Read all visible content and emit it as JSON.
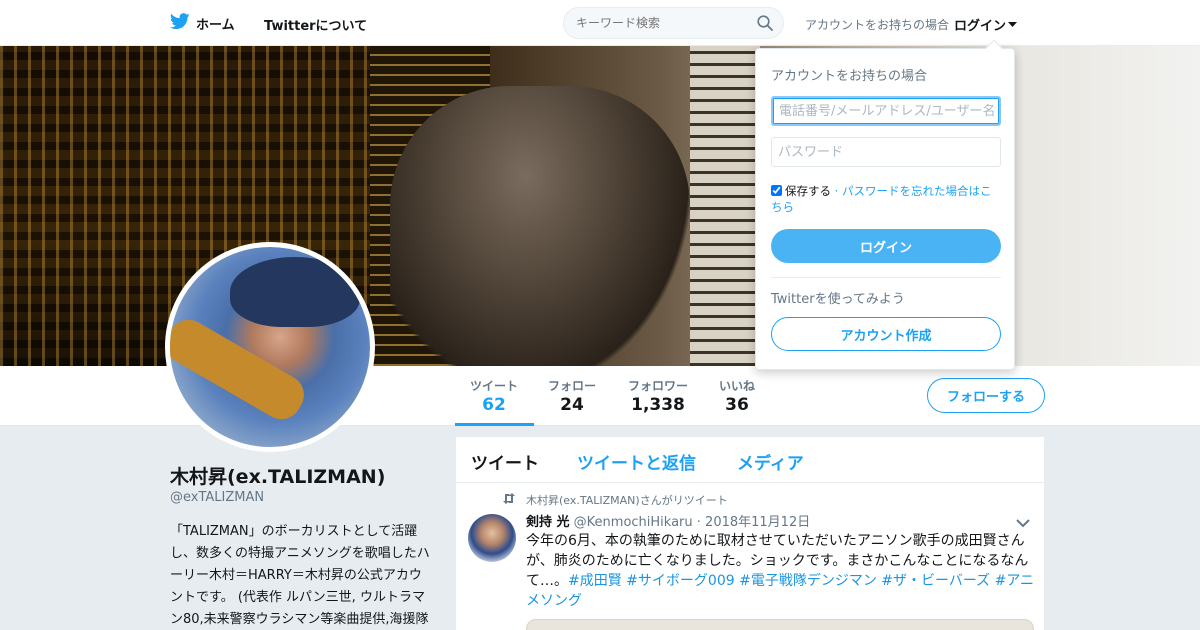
{
  "nav": {
    "home_label": "ホーム",
    "about_label": "Twitterについて",
    "search_placeholder": "キーワード検索",
    "login_prompt": "アカウントをお持ちの場合",
    "login_label": "ログイン"
  },
  "profile": {
    "name": "木村昇(ex.TALIZMAN)",
    "handle": "@exTALIZMAN",
    "bio": "「TALIZMAN」のボーカリストとして活躍し、数多くの特撮アニメソングを歌唱したハーリー木村＝HARRY＝木村昇の公式アカウントです。 (代表作 ルパン三世, ウルトラマン80,未来警察ウラシマン等楽曲提供,海援隊 吉昨mic等)お仕事のご用"
  },
  "stats": [
    {
      "label": "ツイート",
      "value": "62"
    },
    {
      "label": "フォロー",
      "value": "24"
    },
    {
      "label": "フォロワー",
      "value": "1,338"
    },
    {
      "label": "いいね",
      "value": "36"
    }
  ],
  "follow_button": "フォローする",
  "tabs": [
    "ツイート",
    "ツイートと返信",
    "メディア"
  ],
  "tweet": {
    "retweet_note": "木村昇(ex.TALIZMAN)さんがリツイート",
    "author_name": "剣持 光",
    "author_handle": "@KenmochiHikaru",
    "date": "· 2018年11月12日",
    "text": "今年の6月、本の執筆のために取材させていただいたアニソン歌手の成田賢さんが、肺炎のために亡くなりました。ショックです。まさかこんなことになるなんて…。",
    "hashtags": "#成田賢 #サイボーグ009 #電子戦隊デンジマン #ザ・ビーバーズ #アニメソング"
  },
  "login_dropdown": {
    "title": "アカウントをお持ちの場合",
    "username_placeholder": "電話番号/メールアドレス/ユーザー名",
    "password_placeholder": "パスワード",
    "remember_label": "保存する",
    "forgot_label": "· パスワードを忘れた場合はこちら",
    "login_button": "ログイン",
    "try_label": "Twitterを使ってみよう",
    "signup_button": "アカウント作成"
  },
  "colors": {
    "accent": "#1da1f2",
    "background": "#e6ecf0"
  }
}
